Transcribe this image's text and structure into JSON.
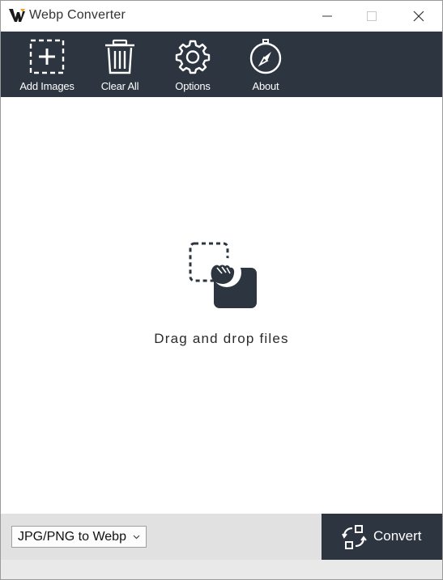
{
  "window": {
    "title": "Webp Converter",
    "controls": {
      "minimize": "minimize-icon",
      "maximize": "maximize-icon",
      "close": "close-icon"
    }
  },
  "toolbar": {
    "items": [
      {
        "label": "Add Images",
        "icon": "add-image-icon"
      },
      {
        "label": "Clear All",
        "icon": "trash-icon"
      },
      {
        "label": "Options",
        "icon": "gear-icon"
      },
      {
        "label": "About",
        "icon": "compass-icon"
      }
    ]
  },
  "drop_area": {
    "message": "Drag and drop files",
    "icon": "drag-drop-icon"
  },
  "footer": {
    "mode_select": {
      "selected": "JPG/PNG to Webp",
      "icon": "chevron-down-icon"
    },
    "convert_button": {
      "label": "Convert",
      "icon": "convert-icon"
    }
  },
  "colors": {
    "toolbar_bg": "#2d3540",
    "footer_bg": "#e1e1e1",
    "accent": "#2d3540"
  }
}
